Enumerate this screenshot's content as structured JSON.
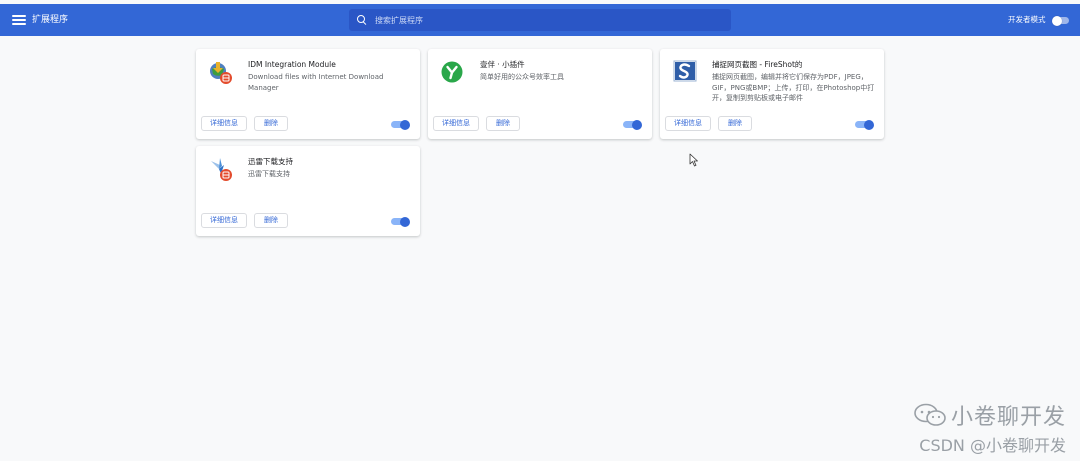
{
  "header": {
    "title": "扩展程序",
    "search_placeholder": "搜索扩展程序",
    "developer_mode_label": "开发者模式",
    "developer_mode_on": false
  },
  "colors": {
    "header_bg": "#3367d6",
    "accent": "#3367d6",
    "page_bg": "#f8f9fa"
  },
  "extensions": [
    {
      "name": "IDM Integration Module",
      "description": "Download files with Internet Download Manager",
      "icon": "idm-icon",
      "details_label": "详细信息",
      "remove_label": "删除",
      "enabled": true
    },
    {
      "name": "壹伴 · 小插件",
      "description": "简单好用的公众号效率工具",
      "icon": "yiban-icon",
      "details_label": "详细信息",
      "remove_label": "删除",
      "enabled": true
    },
    {
      "name": "捕捉网页截图 - FireShot的",
      "description": "捕捉网页截图，编辑并将它们保存为PDF，JPEG，GIF，PNG或BMP；上传，打印，在Photoshop中打开，复制到剪贴板或电子邮件",
      "icon": "fireshot-icon",
      "details_label": "详细信息",
      "remove_label": "删除",
      "enabled": true
    },
    {
      "name": "迅雷下载支持",
      "description": "迅雷下载支持",
      "icon": "xunlei-icon",
      "details_label": "详细信息",
      "remove_label": "删除",
      "enabled": true
    }
  ],
  "watermark": {
    "line1": "小卷聊开发",
    "line2": "CSDN @小卷聊开发"
  }
}
